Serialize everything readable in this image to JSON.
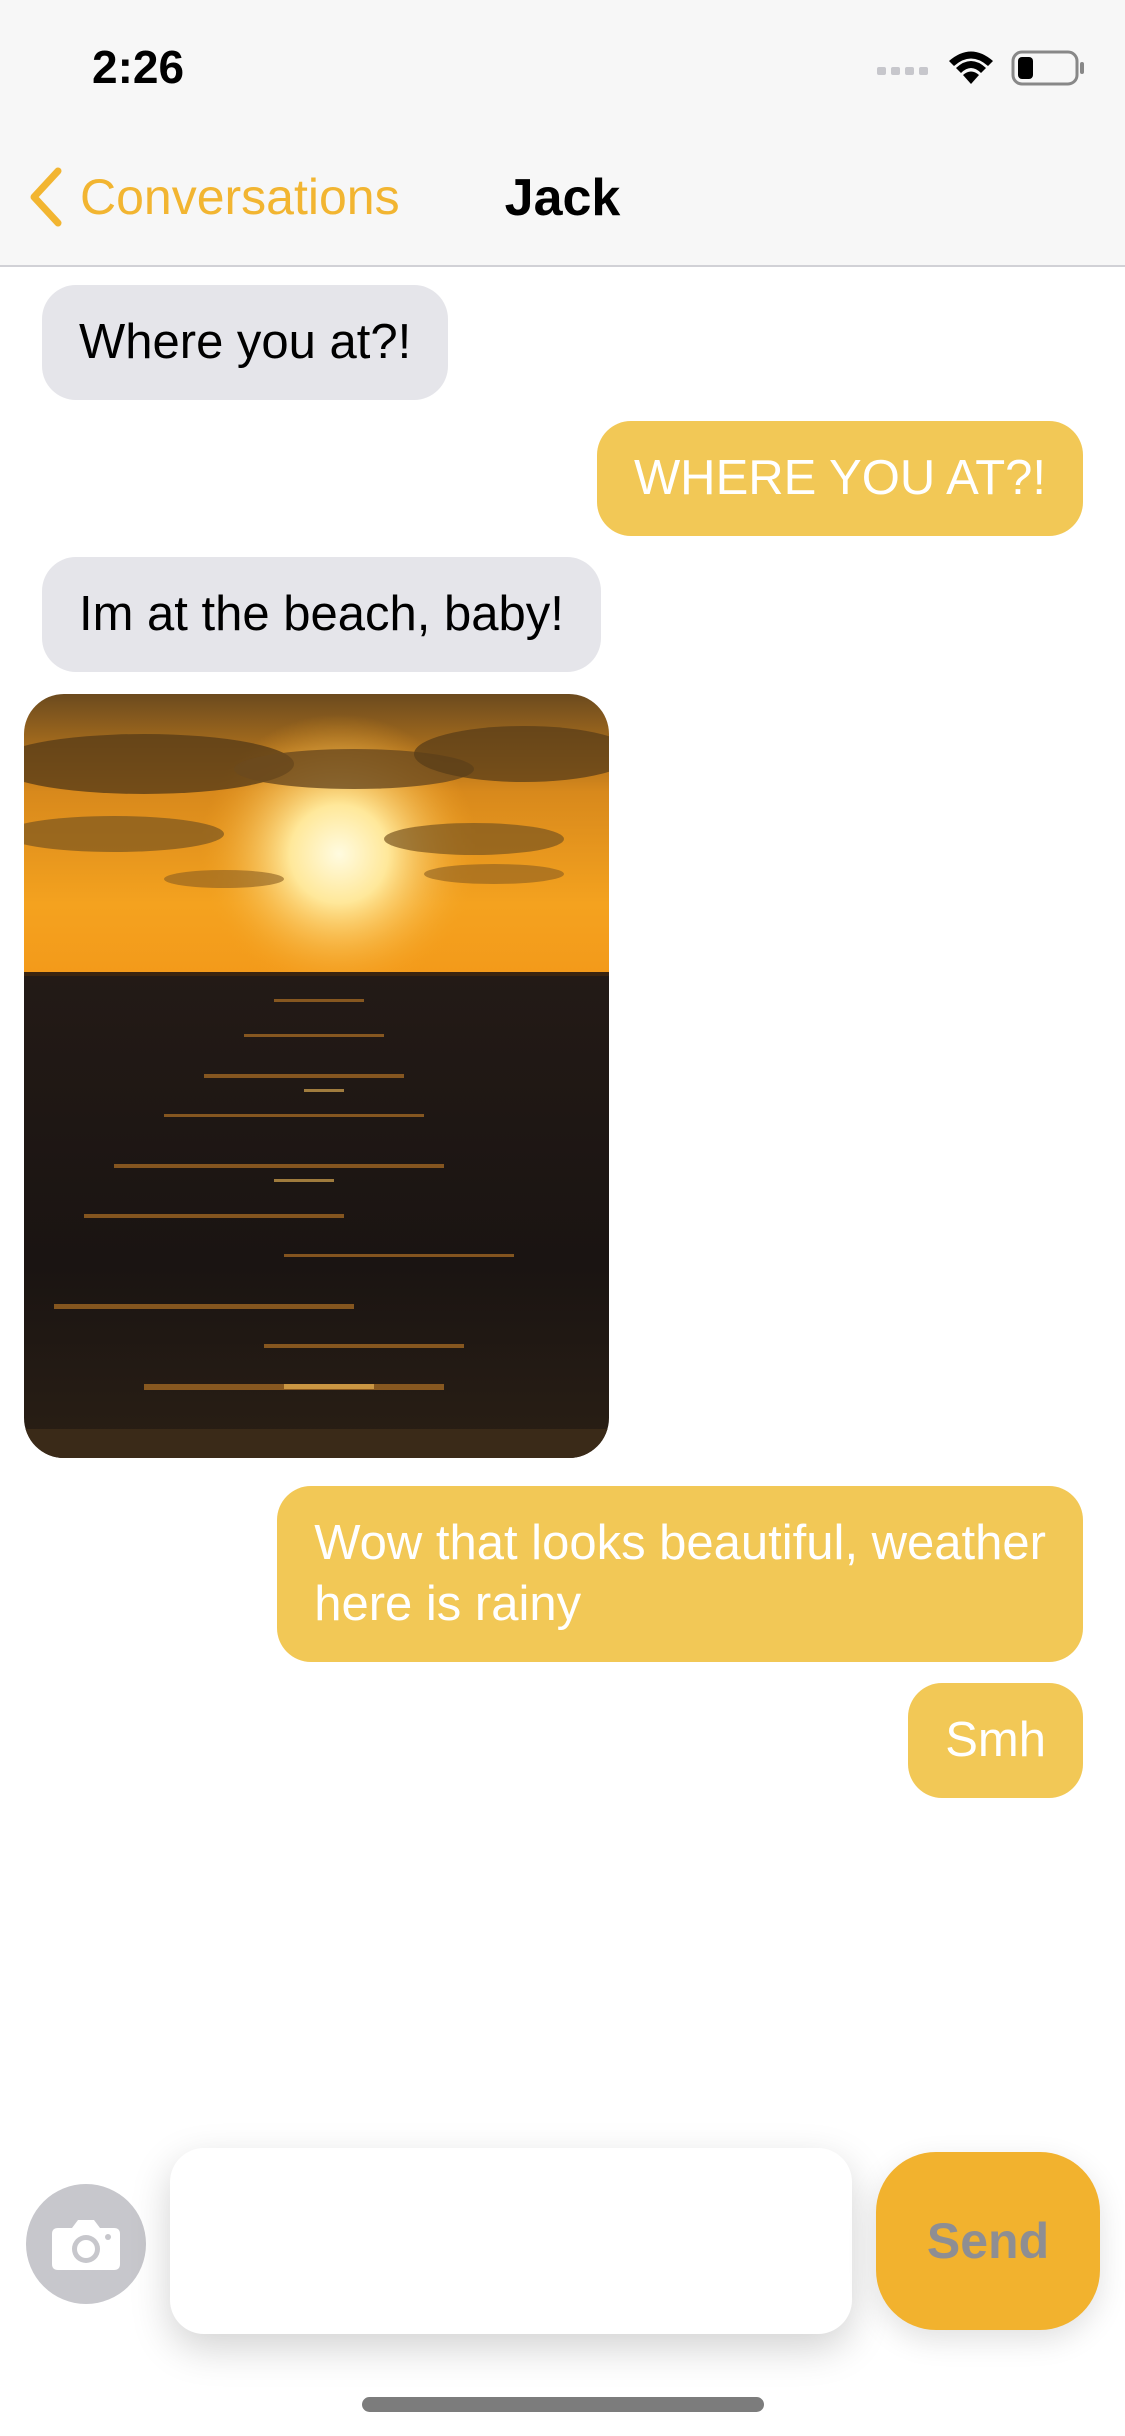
{
  "status_bar": {
    "time": "2:26",
    "icons": [
      "signal-icon",
      "wifi-icon",
      "battery-icon"
    ]
  },
  "nav": {
    "back_label": "Conversations",
    "title": "Jack"
  },
  "messages": [
    {
      "direction": "incoming",
      "text": "Where you at?!"
    },
    {
      "direction": "outgoing",
      "text": "WHERE YOU AT?!"
    },
    {
      "direction": "incoming",
      "text": "Im at the beach, baby!"
    },
    {
      "direction": "incoming",
      "type": "image",
      "image": "sunset-beach-photo"
    },
    {
      "direction": "outgoing",
      "lines": [
        "Wow that looks beautiful, weather",
        "here is rainy"
      ]
    },
    {
      "direction": "outgoing",
      "text": "Smh"
    }
  ],
  "composer": {
    "value": "",
    "send_label": "Send"
  },
  "colors": {
    "accent": "#f2b531",
    "outgoing_bubble": "#f2c856",
    "incoming_bubble": "#e5e5ea",
    "send_button": "#f2b22e"
  }
}
